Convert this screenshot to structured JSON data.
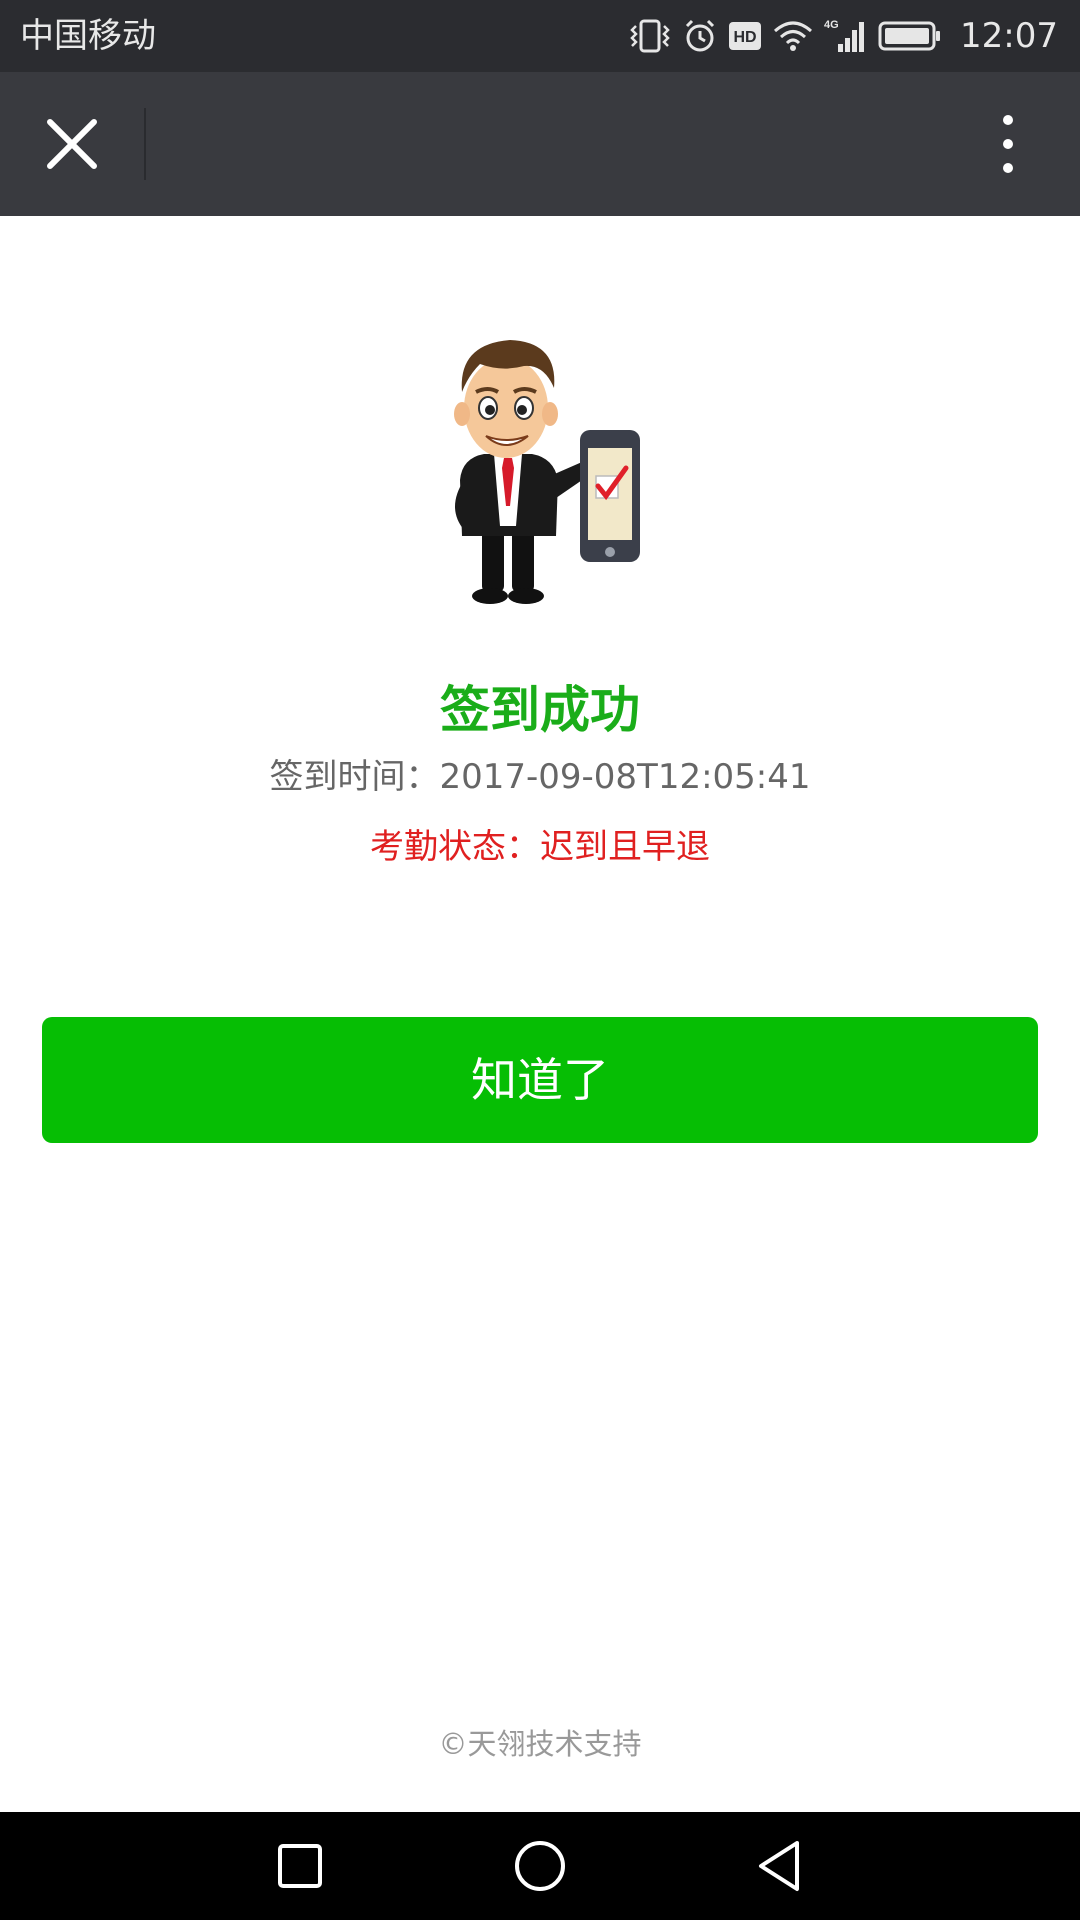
{
  "status_bar": {
    "carrier": "中国移动",
    "network": "4G",
    "hd_label": "HD",
    "time": "12:07",
    "icons": [
      "vibrate-icon",
      "alarm-icon",
      "hd-icon",
      "wifi-icon",
      "signal-icon",
      "battery-icon"
    ]
  },
  "nav_bar": {
    "close_icon": "close-icon",
    "more_icon": "more-vertical-icon"
  },
  "result": {
    "title": "签到成功",
    "sign_time": "签到时间：2017-09-08T12:05:41",
    "attendance_status": "考勤状态：迟到且早退"
  },
  "actions": {
    "ok_label": "知道了"
  },
  "footer": {
    "text": "©天翎技术支持"
  },
  "colors": {
    "success_green": "#1aad19",
    "button_green": "#06be04",
    "status_red": "#e02020",
    "nav_bar": "#393a3f"
  }
}
